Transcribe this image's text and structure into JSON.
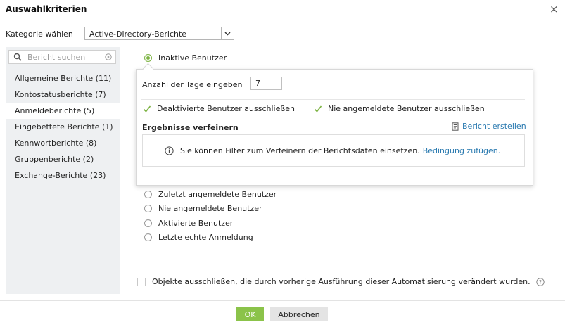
{
  "dialog": {
    "title": "Auswahlkriterien",
    "close_symbol": "×"
  },
  "category": {
    "label": "Kategorie wählen",
    "selected": "Active-Directory-Berichte"
  },
  "search": {
    "placeholder": "Bericht suchen"
  },
  "sidebar": {
    "items": [
      {
        "label": "Allgemeine Berichte (11)",
        "selected": false
      },
      {
        "label": "Kontostatusberichte (7)",
        "selected": false
      },
      {
        "label": "Anmeldeberichte (5)",
        "selected": true
      },
      {
        "label": "Eingebettete Berichte (1)",
        "selected": false
      },
      {
        "label": "Kennwortberichte (8)",
        "selected": false
      },
      {
        "label": "Gruppenberichte (2)",
        "selected": false
      },
      {
        "label": "Exchange-Berichte (23)",
        "selected": false
      }
    ]
  },
  "reports": {
    "selected": "Inaktive Benutzer",
    "options": [
      "Zuletzt angemeldete Benutzer",
      "Nie angemeldete Benutzer",
      "Aktivierte Benutzer",
      "Letzte echte Anmeldung"
    ]
  },
  "popup": {
    "days_label": "Anzahl der Tage eingeben",
    "days_value": "7",
    "checkbox1": "Deaktivierte Benutzer ausschließen",
    "checkbox2": "Nie angemeldete Benutzer ausschließen",
    "refine_title": "Ergebnisse verfeinern",
    "create_report": "Bericht erstellen",
    "info_text": "Sie können Filter zum Verfeinern der Berichtsdaten einsetzen.",
    "info_link": "Bedingung zufügen."
  },
  "exclude": {
    "label": "Objekte ausschließen, die durch vorherige Ausführung dieser Automatisierung verändert wurden."
  },
  "buttons": {
    "ok": "OK",
    "cancel": "Abbrechen"
  },
  "colors": {
    "accent_green": "#8bc34a",
    "link_blue": "#2a7ab0",
    "sidebar_bg": "#eef0f2"
  }
}
